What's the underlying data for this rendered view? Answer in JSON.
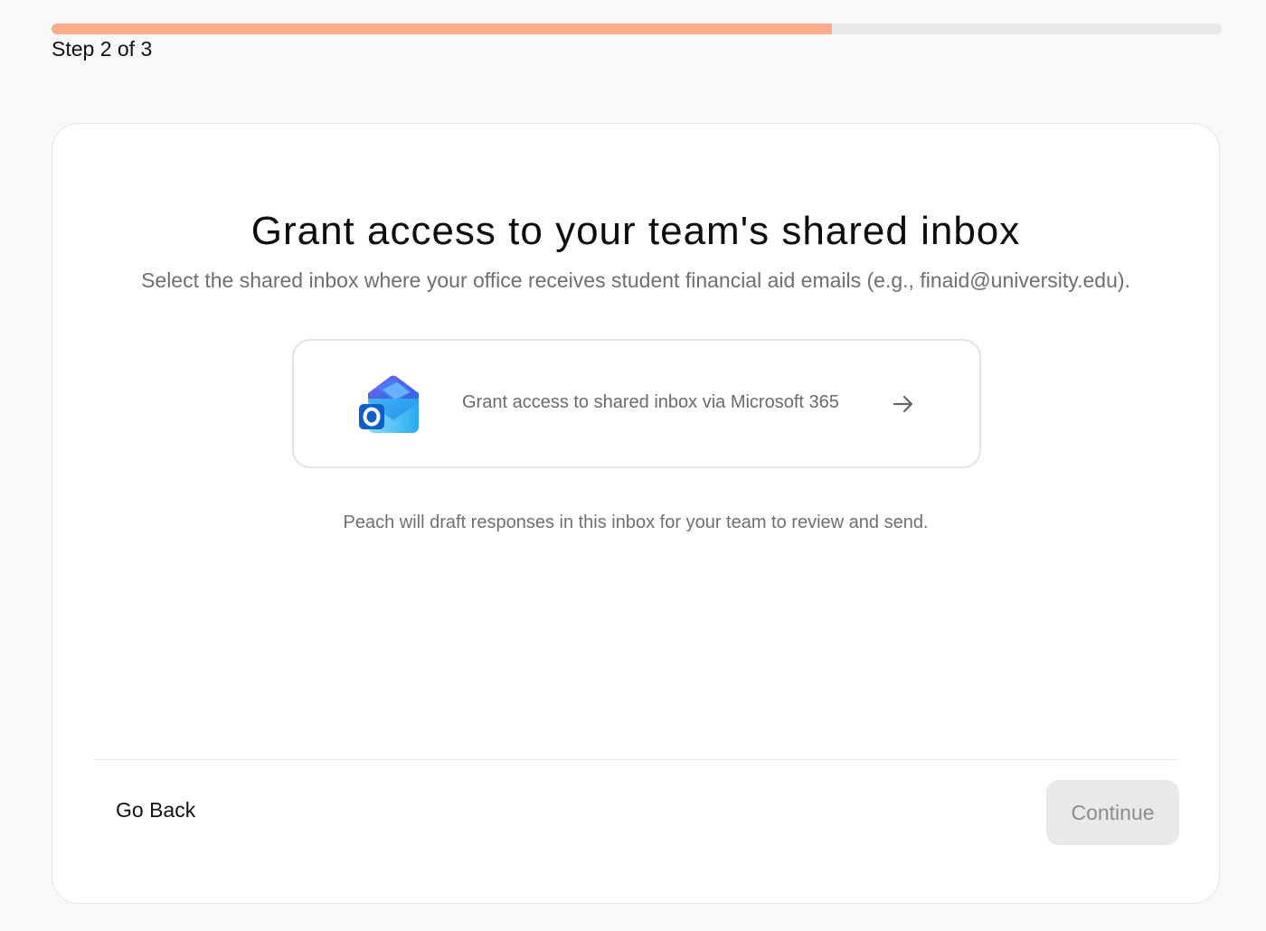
{
  "progress": {
    "label": "Step 2 of 3",
    "fraction": 0.667
  },
  "main": {
    "title": "Grant access to your team's shared inbox",
    "subtitle": "Select the shared inbox where your office receives student financial aid emails (e.g., finaid@university.edu).",
    "ms_button": {
      "label": "Grant access to shared inbox via Microsoft 365",
      "icon": "outlook-icon",
      "trailing_icon": "arrow-right-icon"
    },
    "helper": "Peach will draft responses in this inbox for your team to review and send."
  },
  "footer": {
    "back_label": "Go Back",
    "continue_label": "Continue",
    "continue_disabled": true
  },
  "colors": {
    "progress_fill": "#fcab8c",
    "progress_track": "#e8e8e8",
    "page_bg": "#f8f8f8"
  }
}
